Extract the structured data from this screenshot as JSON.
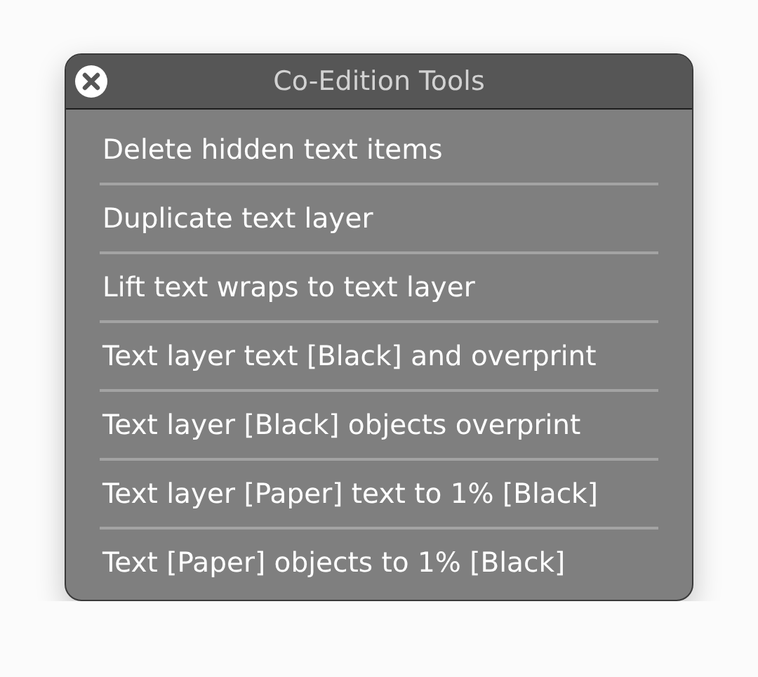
{
  "window": {
    "title": "Co-Edition Tools"
  },
  "items": [
    "Delete hidden text items",
    "Duplicate text layer",
    "Lift text wraps to text layer",
    "Text layer text [Black] and overprint",
    "Text layer [Black] objects overprint",
    "Text layer [Paper] text to 1% [Black]",
    "Text [Paper] objects to 1% [Black]"
  ]
}
